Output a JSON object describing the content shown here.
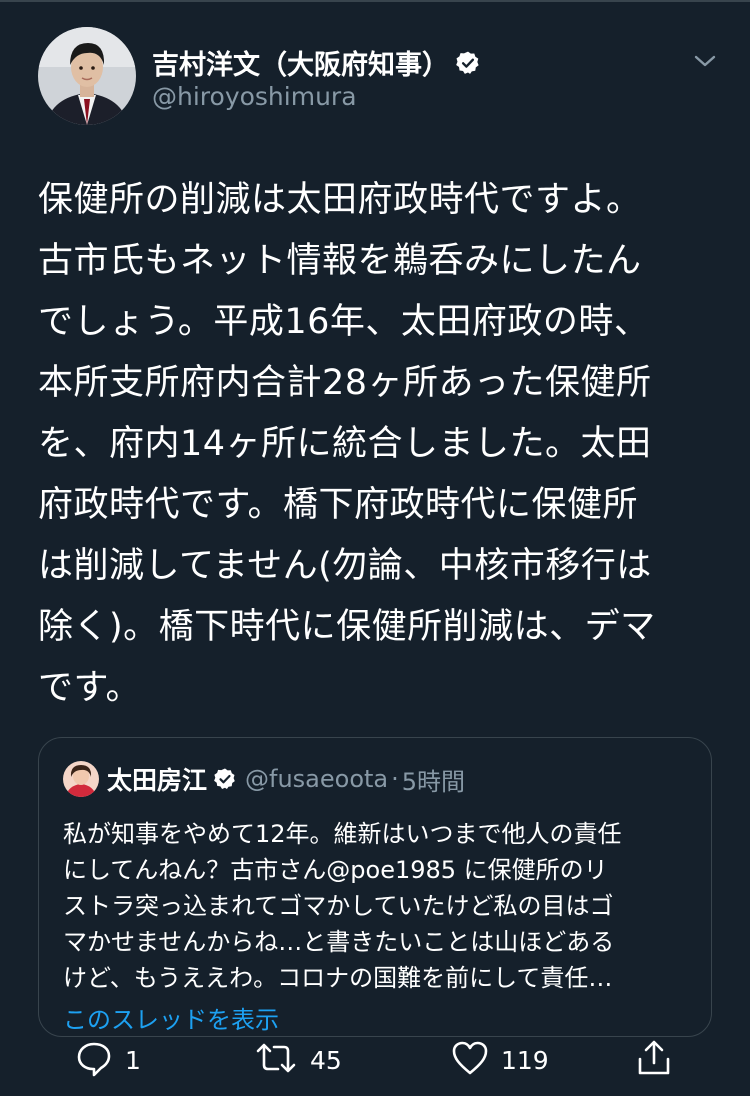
{
  "tweet": {
    "author_name": "吉村洋文（大阪府知事）",
    "author_handle": "@hiroyoshimura",
    "verified_icon": "verified-badge-icon",
    "menu_icon": "chevron-down-icon",
    "text": "保健所の削減は太田府政時代ですよ。\n古市氏もネット情報を鵜呑みにしたん\nでしょう。平成16年、太田府政の時、\n本所支所府内合計28ヶ所あった保健所\nを、府内14ヶ所に統合しました。太田\n府政時代です。橋下府政時代に保健所\nは削減してません(勿論、中核市移行は\n除く)。橋下時代に保健所削減は、デマ\nです。"
  },
  "quote": {
    "author_name": "太田房江",
    "author_handle": "@fusaeoota",
    "separator": "·",
    "time": "5時間",
    "text": "私が知事をやめて12年。維新はいつまで他人の責任\nにしてんねん？古市さん@poe1985 に保健所のリ\nストラ突っ込まれてゴマかしていたけど私の目はゴ\nマかせませんからね…と書きたいことは山ほどある\nけど、もうええわ。コロナの国難を前にして責任…",
    "show_thread": "このスレッドを表示"
  },
  "actions": {
    "reply_count": "1",
    "retweet_count": "45",
    "like_count": "119"
  },
  "colors": {
    "background": "#15202b",
    "secondary_text": "#8899a6",
    "link": "#1da1f2",
    "border": "#38444d"
  }
}
